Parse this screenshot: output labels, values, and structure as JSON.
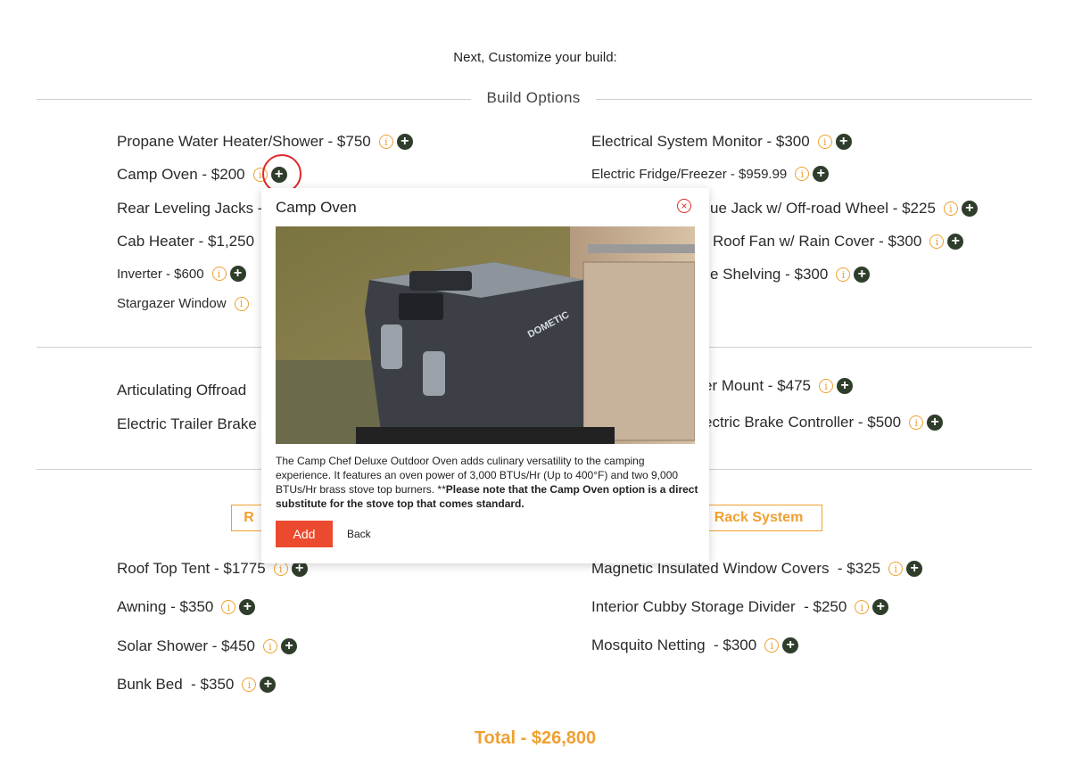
{
  "heading": "Next, Customize your build:",
  "section1_title": "Build Options",
  "left_options": [
    {
      "label": "Propane Water Heater/Shower - $750"
    },
    {
      "label": "Camp Oven - $200"
    },
    {
      "label": "Rear Leveling Jacks -"
    },
    {
      "label": "Cab Heater - $1,250"
    },
    {
      "label": "Inverter - $600"
    },
    {
      "label": "Stargazer Window"
    }
  ],
  "right_options": [
    {
      "label": "Electrical System Monitor - $300"
    },
    {
      "label": "Electric Fridge/Freezer - $959.99"
    },
    {
      "label": "ue Jack w/ Off-road Wheel - $225"
    },
    {
      "label": "Roof Fan w/ Rain Cover - $300"
    },
    {
      "label": "e Shelving - $300"
    }
  ],
  "section2": {
    "left": [
      {
        "label": "Articulating Offroad"
      },
      {
        "label": "Electric Trailer Brake"
      }
    ],
    "right": [
      {
        "label": "er Mount - $475"
      },
      {
        "label": "ectric Brake Controller - $500"
      }
    ]
  },
  "section3": {
    "left_button": "R",
    "right_button": "Rack System",
    "left": [
      {
        "label": "Roof Top Tent - $1775"
      },
      {
        "label": "Awning - $350"
      },
      {
        "label": "Solar Shower - $450"
      },
      {
        "label": "Bunk Bed  - $350"
      }
    ],
    "right": [
      {
        "label": "Magnetic Insulated Window Covers  - $325"
      },
      {
        "label": "Interior Cubby Storage Divider  - $250"
      },
      {
        "label": "Mosquito Netting  - $300"
      }
    ]
  },
  "total": "Total - $26,800",
  "icons": {
    "info": "i",
    "plus": "+",
    "close": "×"
  },
  "colors": {
    "accent": "#f0a030",
    "add_button": "#ec4a2f",
    "plus_icon": "#2f3d2b",
    "highlight": "#e0262a"
  },
  "modal": {
    "title": "Camp Oven",
    "photo_brand": "DOMETIC",
    "description": "The Camp Chef Deluxe Outdoor Oven adds culinary versatility to the camping experience. It features an oven power of 3,000 BTUs/Hr (Up to 400°F) and two 9,000 BTUs/Hr brass stove top burners. **",
    "description_bold": "Please note that the Camp Oven option is a direct substitute for the stove top that comes standard.",
    "add_label": "Add",
    "back_label": "Back"
  }
}
